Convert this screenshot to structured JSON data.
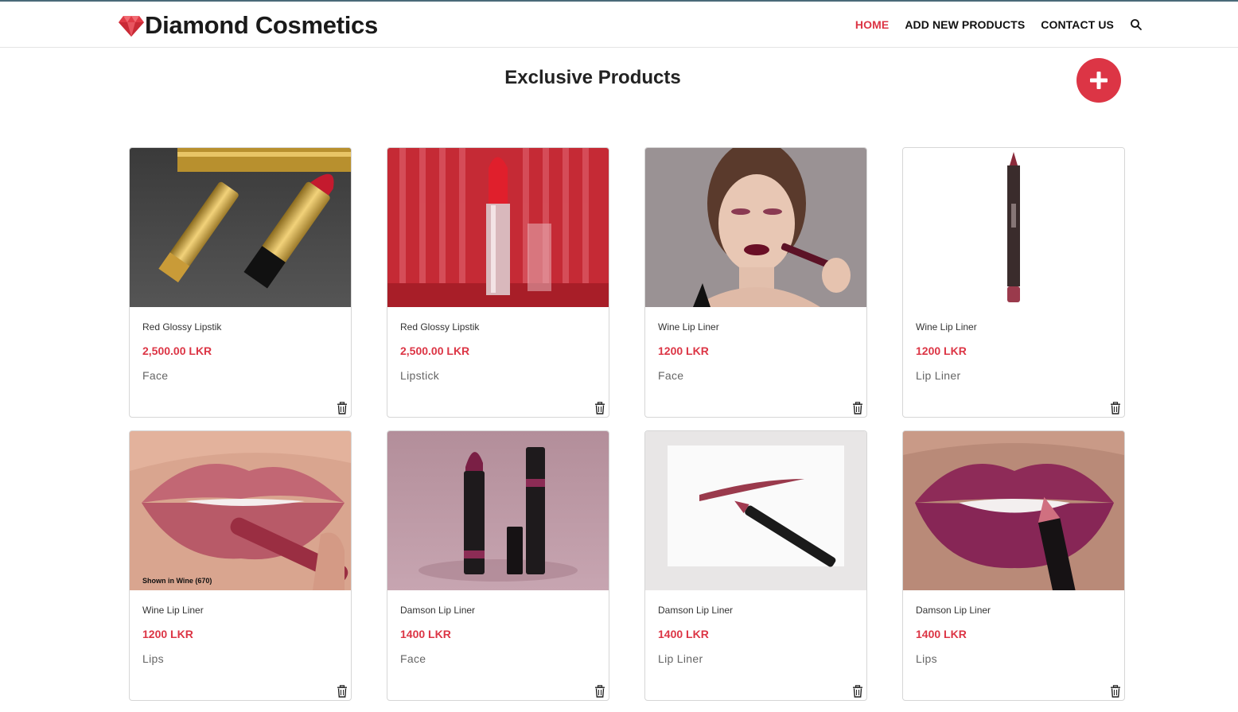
{
  "brand": {
    "name": "Diamond Cosmetics",
    "logo_icon": "diamond-icon",
    "logo_color": "#e03a46"
  },
  "nav": {
    "items": [
      {
        "label": "HOME",
        "active": true
      },
      {
        "label": "ADD NEW PRODUCTS",
        "active": false
      },
      {
        "label": "CONTACT US",
        "active": false
      }
    ],
    "search_icon": "search-icon"
  },
  "page": {
    "title": "Exclusive Products",
    "add_button_icon": "plus-icon",
    "accent": "#dc3545"
  },
  "products": [
    {
      "name": "Red Glossy Lipstik",
      "price": "2,500.00 LKR",
      "category": "Face",
      "image": "gold-lipsticks-photo"
    },
    {
      "name": "Red Glossy Lipstik",
      "price": "2,500.00 LKR",
      "category": "Lipstick",
      "image": "red-lipstick-photo"
    },
    {
      "name": "Wine Lip Liner",
      "price": "1200 LKR",
      "category": "Face",
      "image": "model-lips-photo"
    },
    {
      "name": "Wine Lip Liner",
      "price": "1200 LKR",
      "category": "Lip Liner",
      "image": "lip-liner-pencil-photo"
    },
    {
      "name": "Wine Lip Liner",
      "price": "1200 LKR",
      "category": "Lips",
      "image": "lips-closeup-photo",
      "caption": "Shown in Wine (670)"
    },
    {
      "name": "Damson Lip Liner",
      "price": "1400 LKR",
      "category": "Face",
      "image": "two-lipsticks-photo"
    },
    {
      "name": "Damson Lip Liner",
      "price": "1400 LKR",
      "category": "Lip Liner",
      "image": "liner-swatch-photo"
    },
    {
      "name": "Damson Lip Liner",
      "price": "1400 LKR",
      "category": "Lips",
      "image": "purple-lips-photo"
    }
  ],
  "delete_icon": "trash-icon"
}
